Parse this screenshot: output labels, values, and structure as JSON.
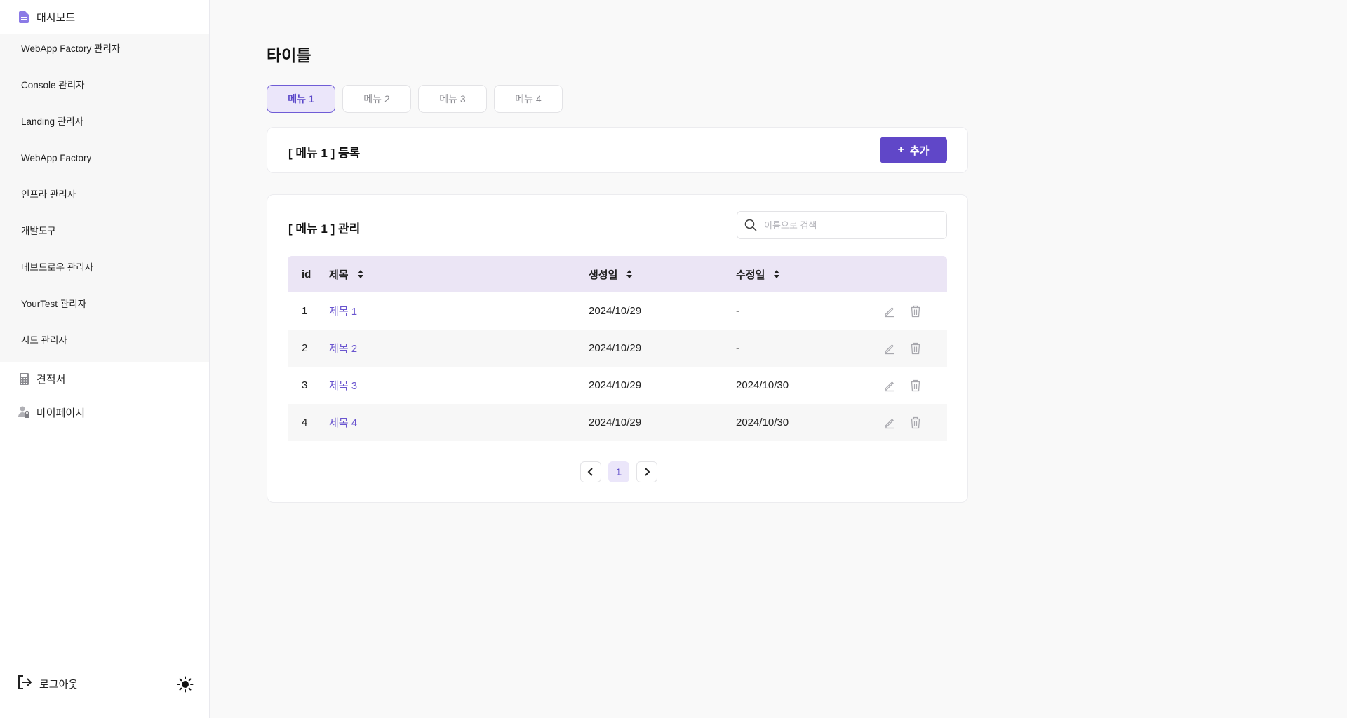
{
  "sidebar": {
    "dashboard_label": "대시보드",
    "sub_items": [
      {
        "label": "WebApp Factory 관리자"
      },
      {
        "label": "Console 관리자"
      },
      {
        "label": "Landing 관리자"
      },
      {
        "label": "WebApp Factory"
      },
      {
        "label": "인프라 관리자"
      },
      {
        "label": "개발도구"
      },
      {
        "label": "데브드로우 관리자"
      },
      {
        "label": "YourTest 관리자"
      },
      {
        "label": "시드 관리자"
      }
    ],
    "estimate_label": "견적서",
    "mypage_label": "마이페이지",
    "logout_label": "로그아웃",
    "icons": {
      "dashboard": "document-icon",
      "estimate": "calculator-icon",
      "mypage": "user-lock-icon",
      "logout": "logout-icon",
      "theme": "sun-icon"
    }
  },
  "page": {
    "title": "타이틀",
    "tabs": [
      {
        "label": "메뉴 1",
        "active": true
      },
      {
        "label": "메뉴 2",
        "active": false
      },
      {
        "label": "메뉴 3",
        "active": false
      },
      {
        "label": "메뉴 4",
        "active": false
      }
    ]
  },
  "register_card": {
    "heading": "[ 메뉴 1 ] 등록",
    "add_button_plus": "+",
    "add_button_label": "추가"
  },
  "manage_card": {
    "heading": "[ 메뉴 1 ] 관리",
    "search_placeholder": "이름으로 검색",
    "search_value": "",
    "columns": {
      "id": "id",
      "title": "제목",
      "created": "생성일",
      "updated": "수정일"
    },
    "rows": [
      {
        "id": "1",
        "title": "제목 1",
        "created": "2024/10/29",
        "updated": "-"
      },
      {
        "id": "2",
        "title": "제목 2",
        "created": "2024/10/29",
        "updated": "-"
      },
      {
        "id": "3",
        "title": "제목 3",
        "created": "2024/10/29",
        "updated": "2024/10/30"
      },
      {
        "id": "4",
        "title": "제목 4",
        "created": "2024/10/29",
        "updated": "2024/10/30"
      }
    ],
    "pagination": {
      "current_page": "1"
    }
  },
  "colors": {
    "accent": "#6047c8",
    "accent_light": "#ebe6fa",
    "table_header_bg": "#ebe5f5",
    "link": "#6a55cf"
  }
}
